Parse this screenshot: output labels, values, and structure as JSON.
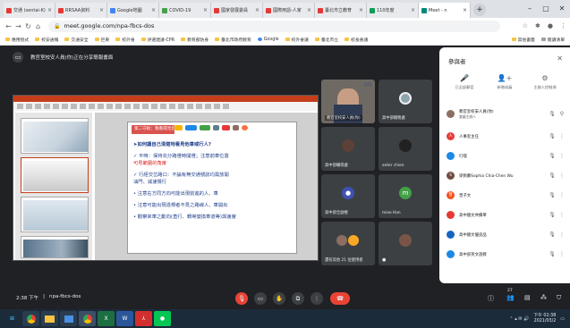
{
  "browser": {
    "tabs": [
      {
        "label": "交通 (sentai-K)",
        "color": "#e53935",
        "active": false
      },
      {
        "label": "RRSAA資料",
        "color": "#e53935",
        "active": false
      },
      {
        "label": "Google地圖",
        "color": "#4285f4",
        "active": false
      },
      {
        "label": "COVID-19",
        "color": "#43a047",
        "active": false
      },
      {
        "label": "國家發展委員",
        "color": "#e53935",
        "active": false
      },
      {
        "label": "國際用語-人家",
        "color": "#e53935",
        "active": false
      },
      {
        "label": "臺北市立教育",
        "color": "#e53935",
        "active": false
      },
      {
        "label": "110年度",
        "color": "#0f9d58",
        "active": false
      },
      {
        "label": "Meet - n",
        "color": "#00897b",
        "active": true
      }
    ],
    "url": "meet.google.com/npa-fbcs-dos",
    "bookmarks": [
      "應用程式",
      "校安通報",
      "交通安全",
      "巨東",
      "校外會",
      "評選建議-CPR",
      "教育部防身",
      "臺北市政府教育",
      "Google",
      "校外會議",
      "臺北市立",
      "校長會議"
    ],
    "bookmarks_right": [
      "其他書籤",
      "閱讀清單"
    ]
  },
  "meeting": {
    "presenter_label": "教官室校安人員(你)正在分享簡報畫面",
    "time": "2:38 下午",
    "code": "npa-fbcs-dos",
    "participant_count": "27"
  },
  "slide": {
    "title": "第二守則：我看得見您，交通才會安全",
    "lines": [
      {
        "text": "➤如何讓自己清楚地看見他車或行人?",
        "accent": "看見他車或行人"
      },
      {
        "text": "✓ 平時：保持充分路燈時開燈；注意前車位置",
        "accent": ""
      },
      {
        "text": "     可見範圍的角度 ",
        "accent": ""
      },
      {
        "text": "✓ 行經交岔路口：不論有無交通號誌均需放開",
        "accent": "均需放開"
      },
      {
        "text": "     油門、減速慢行",
        "accent": ""
      },
      {
        "text": "  • 注意右方同方向可能出現前進的人、車",
        "accent": "可能出現"
      },
      {
        "text": "  • 注意可能出現違規者不見之路線人、車開出",
        "accent": "可能出現"
      },
      {
        "text": "  • 觀察來車之動向(直行、轉彎變換車道等)與速度",
        "accent": "動向"
      }
    ]
  },
  "tiles": [
    {
      "name": "教官室校安人員(你)",
      "avatar": "",
      "color": ""
    },
    {
      "name": "高中部總務處",
      "avatar": "",
      "color": ""
    },
    {
      "name": "高中部輔導處",
      "avatar": "",
      "color": ""
    },
    {
      "name": "anter chien",
      "avatar": "",
      "color": ""
    },
    {
      "name": "高中部全副棍",
      "avatar": "",
      "color": "#3f51b5"
    },
    {
      "name": "miao Han",
      "avatar": "m",
      "color": "#43a047"
    },
    {
      "name": "還有其他 21 位使用者",
      "avatar": "",
      "color": ""
    },
    {
      "name": "",
      "avatar": "",
      "color": ""
    }
  ],
  "panel": {
    "title": "參與者",
    "actions": [
      "已全部靜音",
      "新增成員",
      "主辦人控制項"
    ],
    "participants": [
      {
        "name": "教官室校安人員(你)",
        "sub": "會議主辦人",
        "color": "#8d6e63",
        "initial": ""
      },
      {
        "name": "人事室主任",
        "sub": "",
        "color": "#e53935",
        "initial": "人"
      },
      {
        "name": "叮噹",
        "sub": "",
        "color": "#1e88e5",
        "initial": ""
      },
      {
        "name": "梁佩蓁Sophia Chia-Chen Wu",
        "sub": "",
        "color": "#6d4c41",
        "initial": "S"
      },
      {
        "name": "曾子文",
        "sub": "",
        "color": "#f4511e",
        "initial": "曾"
      },
      {
        "name": "高中國文共備單",
        "sub": "",
        "color": "#e53935",
        "initial": ""
      },
      {
        "name": "高中國文優良品",
        "sub": "",
        "color": "#1565c0",
        "initial": ""
      },
      {
        "name": "高中部英文語教",
        "sub": "",
        "color": "#1e88e5",
        "initial": ""
      }
    ]
  },
  "taskbar": {
    "apps": [
      "Chrome",
      "Explorer",
      "Photos",
      "Chrome",
      "Excel",
      "Word",
      "PDF",
      "LINE"
    ],
    "time": "下午 02:38",
    "date": "2021/03/2"
  }
}
